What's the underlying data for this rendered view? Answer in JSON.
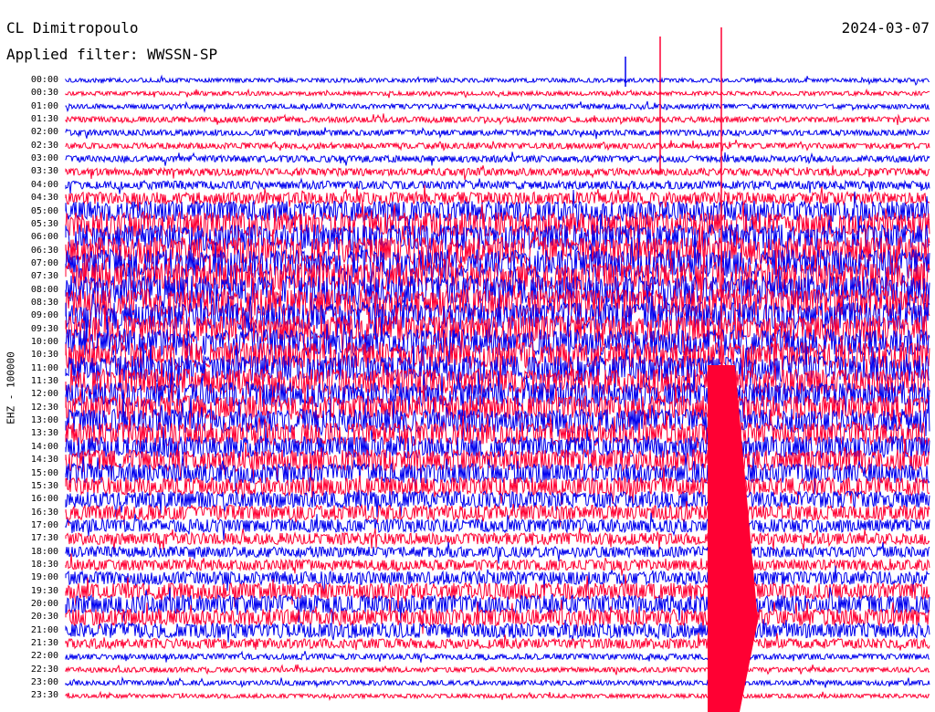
{
  "header": {
    "station": "CL Dimitropoulo",
    "date": "2024-03-07",
    "filter": "Applied filter: WWSSN-SP"
  },
  "channel_label": "EHZ - 100000",
  "time_labels": [
    "00:00",
    "00:30",
    "01:00",
    "01:30",
    "02:00",
    "02:30",
    "03:00",
    "03:30",
    "04:00",
    "04:30",
    "05:00",
    "05:30",
    "06:00",
    "06:30",
    "07:00",
    "07:30",
    "08:00",
    "08:30",
    "09:00",
    "09:30",
    "10:00",
    "10:30",
    "11:00",
    "11:30",
    "12:00",
    "12:30",
    "13:00",
    "13:30",
    "14:00",
    "14:30",
    "15:00",
    "15:30",
    "16:00",
    "16:30",
    "17:00",
    "17:30",
    "18:00",
    "18:30",
    "19:00",
    "19:30",
    "20:00",
    "20:30",
    "21:00",
    "21:30",
    "22:00",
    "22:30",
    "23:00",
    "23:30"
  ],
  "colors": {
    "trace_a": "#0000ee",
    "trace_b": "#ff0033",
    "background": "#ffffff"
  },
  "trace_intensity": [
    0.5,
    0.5,
    0.6,
    0.7,
    0.7,
    0.7,
    0.8,
    0.9,
    1.0,
    1.5,
    2.5,
    3.0,
    3.2,
    3.3,
    3.5,
    3.5,
    3.5,
    3.4,
    3.3,
    3.3,
    3.2,
    3.2,
    3.2,
    3.1,
    3.0,
    3.0,
    2.9,
    2.8,
    2.7,
    2.6,
    2.4,
    2.2,
    2.0,
    1.8,
    1.6,
    1.4,
    1.3,
    1.3,
    1.6,
    2.0,
    2.2,
    2.0,
    1.8,
    1.2,
    0.7,
    0.6,
    0.6,
    0.5
  ]
}
